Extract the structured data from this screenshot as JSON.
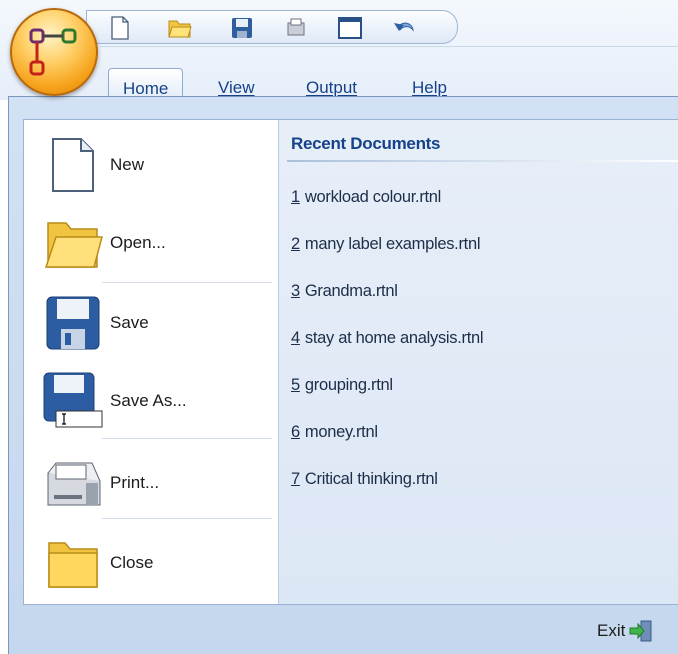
{
  "quick_access": {
    "icons": [
      "new-document-icon",
      "open-folder-icon",
      "save-disk-icon",
      "printer-icon",
      "window-icon",
      "undo-icon"
    ]
  },
  "tabs": [
    {
      "label": "Home",
      "active": true
    },
    {
      "label": "View",
      "active": false
    },
    {
      "label": "Output",
      "active": false
    },
    {
      "label": "Help",
      "active": false
    }
  ],
  "commands": [
    {
      "label": "New",
      "icon": "new-document-icon"
    },
    {
      "label": "Open...",
      "icon": "open-folder-icon"
    },
    {
      "label": "Save",
      "icon": "save-disk-icon"
    },
    {
      "label": "Save As...",
      "icon": "save-as-icon"
    },
    {
      "label": "Print...",
      "icon": "printer-icon"
    },
    {
      "label": "Close",
      "icon": "close-folder-icon"
    }
  ],
  "recent": {
    "title": "Recent Documents",
    "items": [
      {
        "num": "1",
        "name": "workload colour.rtnl"
      },
      {
        "num": "2",
        "name": "many label examples.rtnl"
      },
      {
        "num": "3",
        "name": "Grandma.rtnl"
      },
      {
        "num": "4",
        "name": "stay at home analysis.rtnl"
      },
      {
        "num": "5",
        "name": "grouping.rtnl"
      },
      {
        "num": "6",
        "name": "money.rtnl"
      },
      {
        "num": "7",
        "name": "Critical thinking.rtnl"
      }
    ]
  },
  "footer": {
    "exit_label": "Exit",
    "exit_icon": "exit-door-icon"
  },
  "colors": {
    "accent": "#15428b",
    "menu_background": "#c9dbf1",
    "orb": "#f6a21a"
  }
}
